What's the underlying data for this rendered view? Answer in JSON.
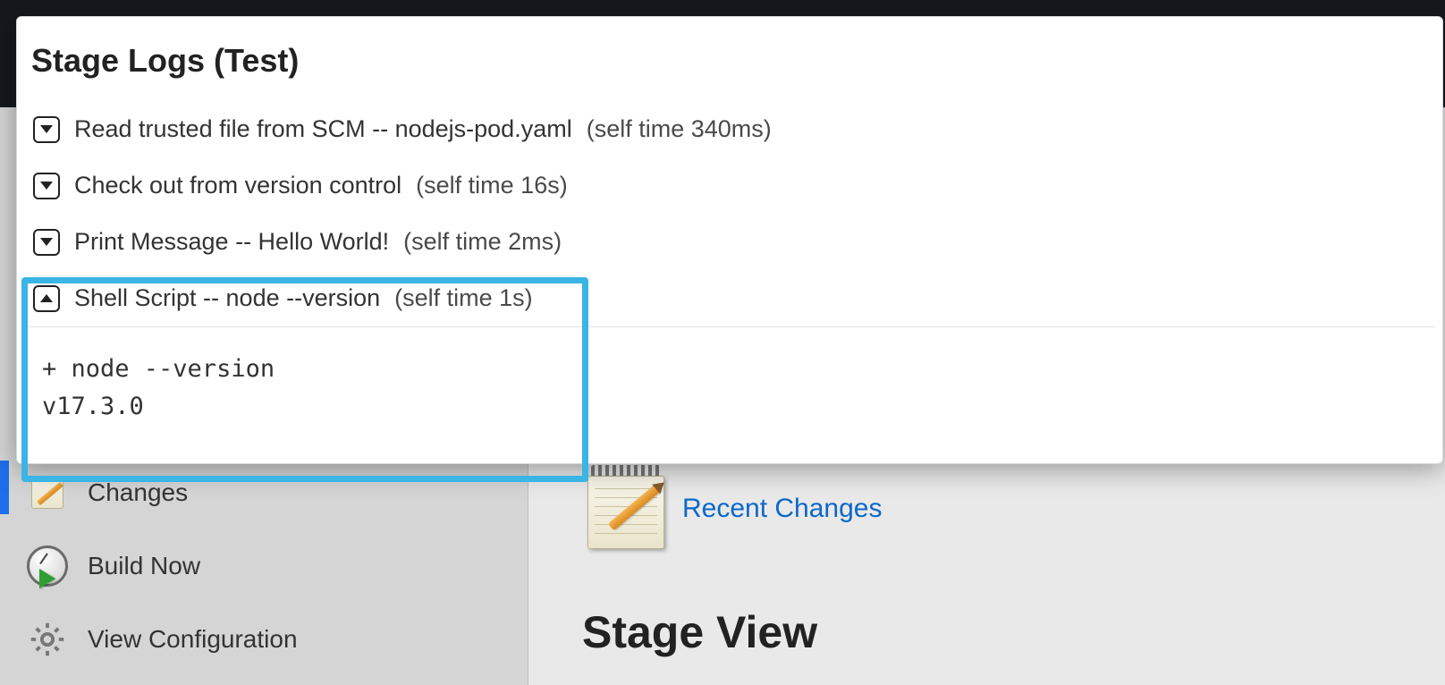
{
  "modal": {
    "title": "Stage Logs (Test)",
    "steps": [
      {
        "expanded": false,
        "title": "Read trusted file from SCM -- nodejs-pod.yaml",
        "self_time": "(self time 340ms)",
        "output": ""
      },
      {
        "expanded": false,
        "title": "Check out from version control",
        "self_time": "(self time 16s)",
        "output": ""
      },
      {
        "expanded": false,
        "title": "Print Message -- Hello World!",
        "self_time": "(self time 2ms)",
        "output": ""
      },
      {
        "expanded": true,
        "title": "Shell Script -- node --version",
        "self_time": "(self time 1s)",
        "output": "+ node --version\nv17.3.0"
      }
    ]
  },
  "sidebar": {
    "items": [
      {
        "label": "Changes"
      },
      {
        "label": "Build Now"
      },
      {
        "label": "View Configuration"
      }
    ]
  },
  "main": {
    "recent_changes": "Recent Changes",
    "stage_view": "Stage View"
  }
}
